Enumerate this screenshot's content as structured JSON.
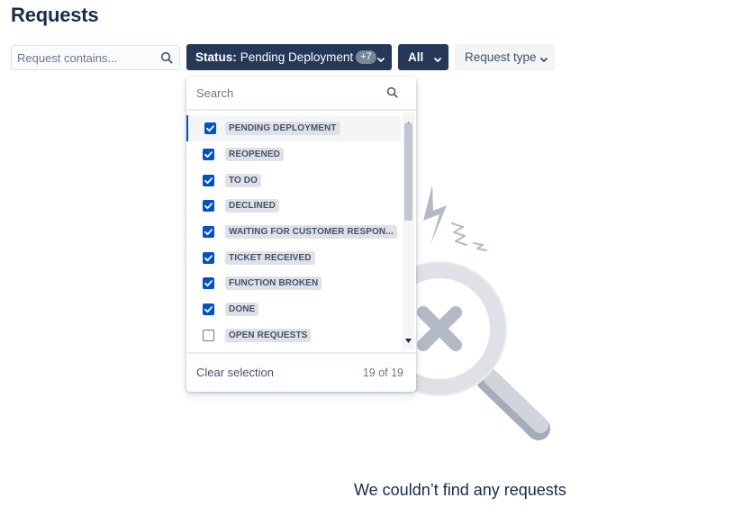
{
  "page": {
    "title": "Requests"
  },
  "filters": {
    "search_placeholder": "Request contains...",
    "status": {
      "label": "Status:",
      "value": "Pending Deployment",
      "badge": "+7"
    },
    "all_label": "All",
    "request_type_label": "Request type"
  },
  "dropdown": {
    "search_placeholder": "Search",
    "items": [
      {
        "label": "PENDING DEPLOYMENT",
        "checked": true,
        "active": true
      },
      {
        "label": "REOPENED",
        "checked": true
      },
      {
        "label": "TO DO",
        "checked": true
      },
      {
        "label": "DECLINED",
        "checked": true
      },
      {
        "label": "WAITING FOR CUSTOMER RESPON...",
        "checked": true
      },
      {
        "label": "TICKET RECEIVED",
        "checked": true
      },
      {
        "label": "FUNCTION BROKEN",
        "checked": true
      },
      {
        "label": "DONE",
        "checked": true
      },
      {
        "label": "OPEN REQUESTS",
        "checked": false
      }
    ],
    "clear_label": "Clear selection",
    "count": "19 of 19"
  },
  "empty_state": {
    "message": "We couldn’t find any requests"
  },
  "colors": {
    "primary_button": "#253858",
    "checkbox": "#0052cc",
    "text": "#172b4d"
  },
  "icons": {
    "search": "search-icon",
    "chevron": "chevron-down-icon",
    "illustration": "no-results-magnifier-icon"
  }
}
